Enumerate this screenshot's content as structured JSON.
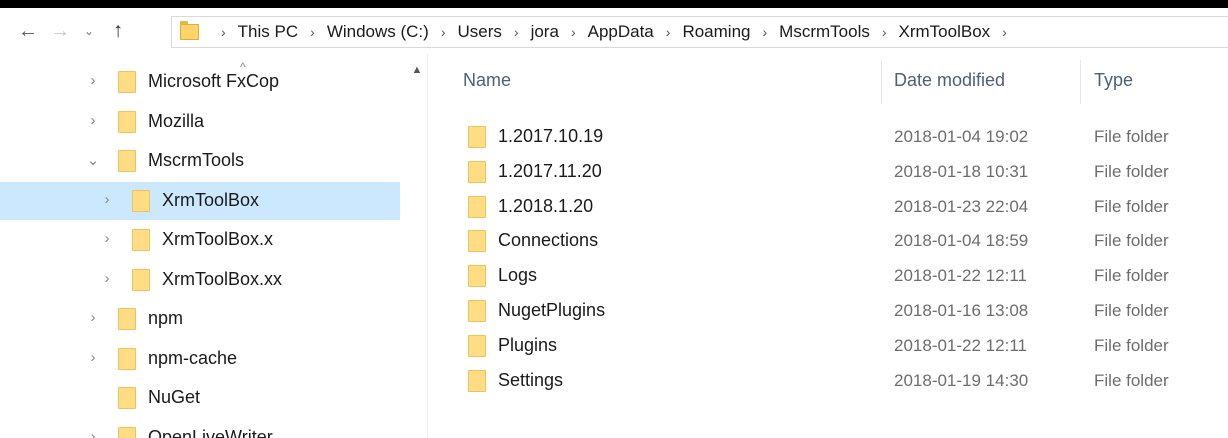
{
  "toolbar": {
    "back_icon": "←",
    "forward_icon": "→",
    "recent_icon": "⌄",
    "up_icon": "↑",
    "breadcrumb_sep": "›"
  },
  "address_bar": {
    "crumbs": [
      "This PC",
      "Windows (C:)",
      "Users",
      "jora",
      "AppData",
      "Roaming",
      "MscrmTools",
      "XrmToolBox"
    ]
  },
  "nav": {
    "scroll_up_icon": "▲",
    "collapsed_chevron": "›",
    "expanded_chevron": "⌄",
    "items": [
      {
        "label": "Microsoft FxCop",
        "state": "collapsed"
      },
      {
        "label": "Mozilla",
        "state": "collapsed"
      },
      {
        "label": "MscrmTools",
        "state": "expanded"
      },
      {
        "label": "XrmToolBox",
        "state": "collapsed",
        "selected": true
      },
      {
        "label": "XrmToolBox.x",
        "state": "collapsed"
      },
      {
        "label": "XrmToolBox.xx",
        "state": "collapsed"
      },
      {
        "label": "npm",
        "state": "collapsed"
      },
      {
        "label": "npm-cache",
        "state": "collapsed"
      },
      {
        "label": "NuGet",
        "state": "none"
      },
      {
        "label": "OpenLiveWriter",
        "state": "collapsed"
      }
    ]
  },
  "columns": {
    "name": "Name",
    "date": "Date modified",
    "type": "Type",
    "sort_icon": "^"
  },
  "files": [
    {
      "name": "1.2017.10.19",
      "date": "2018-01-04 19:02",
      "type": "File folder"
    },
    {
      "name": "1.2017.11.20",
      "date": "2018-01-18 10:31",
      "type": "File folder"
    },
    {
      "name": "1.2018.1.20",
      "date": "2018-01-23 22:04",
      "type": "File folder"
    },
    {
      "name": "Connections",
      "date": "2018-01-04 18:59",
      "type": "File folder"
    },
    {
      "name": "Logs",
      "date": "2018-01-22 12:11",
      "type": "File folder"
    },
    {
      "name": "NugetPlugins",
      "date": "2018-01-16 13:08",
      "type": "File folder"
    },
    {
      "name": "Plugins",
      "date": "2018-01-22 12:11",
      "type": "File folder"
    },
    {
      "name": "Settings",
      "date": "2018-01-19 14:30",
      "type": "File folder"
    }
  ],
  "colors": {
    "selection": "#cce8ff",
    "folder": "#ffdd85",
    "header_text": "#4c607a"
  }
}
